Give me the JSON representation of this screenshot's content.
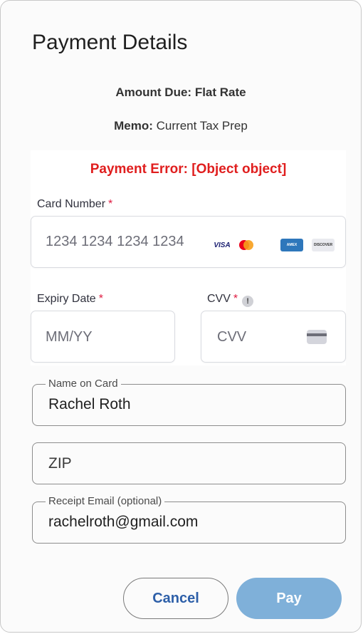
{
  "dialog": {
    "title": "Payment Details",
    "amount_label": "Amount Due:",
    "amount_value": "Flat Rate",
    "memo_label": "Memo:",
    "memo_value": "Current Tax Prep"
  },
  "payment": {
    "error": "Payment Error: [Object object]",
    "card_number": {
      "label": "Card Number",
      "required_mark": "*",
      "placeholder": "1234 1234 1234 1234"
    },
    "brands": [
      {
        "name": "VISA",
        "icon": "visa-logo"
      },
      {
        "name": "Mastercard",
        "icon": "mastercard-logo"
      },
      {
        "name": "American Express",
        "icon": "amex-logo"
      },
      {
        "name": "DISCOVER",
        "icon": "discover-logo"
      }
    ],
    "expiry": {
      "label": "Expiry Date",
      "required_mark": "*",
      "placeholder": "MM/YY"
    },
    "cvv": {
      "label": "CVV",
      "required_mark": "*",
      "info": "!",
      "placeholder": "CVV"
    }
  },
  "form": {
    "name_on_card": {
      "label": "Name on Card",
      "value": "Rachel Roth"
    },
    "zip": {
      "placeholder": "ZIP"
    },
    "receipt_email": {
      "label": "Receipt Email (optional)",
      "value": "rachelroth@gmail.com"
    }
  },
  "actions": {
    "cancel": "Cancel",
    "pay": "Pay"
  },
  "colors": {
    "error": "#e01e1e",
    "pay_button": "#7fb0d9",
    "cancel_text": "#2d5fa8",
    "required": "#df1b41"
  }
}
